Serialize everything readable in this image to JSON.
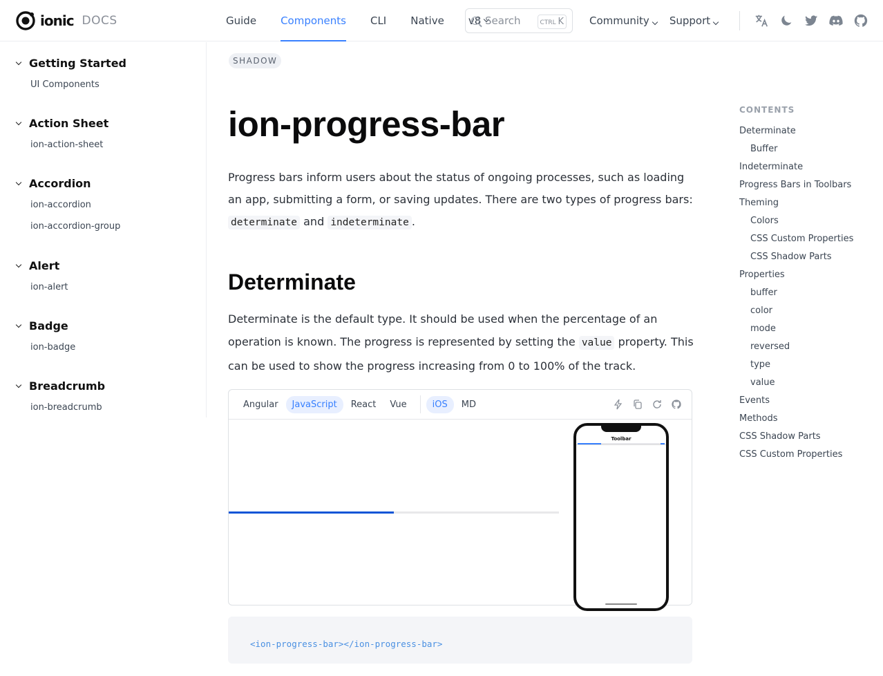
{
  "header": {
    "brand": "ionic",
    "docs_label": "DOCS",
    "nav": [
      {
        "label": "Guide",
        "active": false
      },
      {
        "label": "Components",
        "active": true
      },
      {
        "label": "CLI",
        "active": false
      },
      {
        "label": "Native",
        "active": false
      },
      {
        "label": "v8",
        "active": false
      }
    ],
    "search": {
      "placeholder": "Search",
      "shortcut_mod": "CTRL",
      "shortcut_key": "K"
    },
    "nav_right": [
      {
        "label": "Community"
      },
      {
        "label": "Support"
      }
    ],
    "icons": [
      "translate-icon",
      "moon-icon",
      "twitter-icon",
      "discord-icon",
      "github-icon"
    ],
    "accent": "#3880ff"
  },
  "sidebar": {
    "groups": [
      {
        "title": "Getting Started",
        "links": [
          "UI Components"
        ]
      },
      {
        "title": "Action Sheet",
        "links": [
          "ion-action-sheet"
        ]
      },
      {
        "title": "Accordion",
        "links": [
          "ion-accordion",
          "ion-accordion-group"
        ]
      },
      {
        "title": "Alert",
        "links": [
          "ion-alert"
        ]
      },
      {
        "title": "Badge",
        "links": [
          "ion-badge"
        ]
      },
      {
        "title": "Breadcrumb",
        "links": [
          "ion-breadcrumb"
        ]
      }
    ]
  },
  "main": {
    "badge": "SHADOW",
    "title": "ion-progress-bar",
    "intro_1": "Progress bars inform users about the status of ongoing processes, such as loading an app, submitting a form, or saving updates. There are two types of progress bars: ",
    "intro_code_1": "determinate",
    "intro_2": " and ",
    "intro_code_2": "indeterminate",
    "intro_3": ".",
    "section_title": "Determinate",
    "det_1": "Determinate is the default type. It should be used when the percentage of an operation is known. The progress is represented by setting the ",
    "det_code": "value",
    "det_2": " property. This can be used to show the progress increasing from 0 to 100% of the track.",
    "demo": {
      "frameworks": [
        {
          "label": "Angular",
          "active": false
        },
        {
          "label": "JavaScript",
          "active": true
        },
        {
          "label": "React",
          "active": false
        },
        {
          "label": "Vue",
          "active": false
        }
      ],
      "modes": [
        {
          "label": "iOS",
          "active": true
        },
        {
          "label": "MD",
          "active": false
        }
      ],
      "progress_value": 0.5,
      "progress_color": "#0a54d6",
      "phone_toolbar": "Toolbar"
    },
    "code": "<ion-progress-bar></ion-progress-bar>"
  },
  "toc": {
    "heading": "CONTENTS",
    "items": [
      {
        "label": "Determinate",
        "sub": false
      },
      {
        "label": "Buffer",
        "sub": true
      },
      {
        "label": "Indeterminate",
        "sub": false
      },
      {
        "label": "Progress Bars in Toolbars",
        "sub": false
      },
      {
        "label": "Theming",
        "sub": false
      },
      {
        "label": "Colors",
        "sub": true
      },
      {
        "label": "CSS Custom Properties",
        "sub": true
      },
      {
        "label": "CSS Shadow Parts",
        "sub": true
      },
      {
        "label": "Properties",
        "sub": false
      },
      {
        "label": "buffer",
        "sub": true
      },
      {
        "label": "color",
        "sub": true
      },
      {
        "label": "mode",
        "sub": true
      },
      {
        "label": "reversed",
        "sub": true
      },
      {
        "label": "type",
        "sub": true
      },
      {
        "label": "value",
        "sub": true
      },
      {
        "label": "Events",
        "sub": false
      },
      {
        "label": "Methods",
        "sub": false
      },
      {
        "label": "CSS Shadow Parts",
        "sub": false
      },
      {
        "label": "CSS Custom Properties",
        "sub": false
      }
    ]
  }
}
